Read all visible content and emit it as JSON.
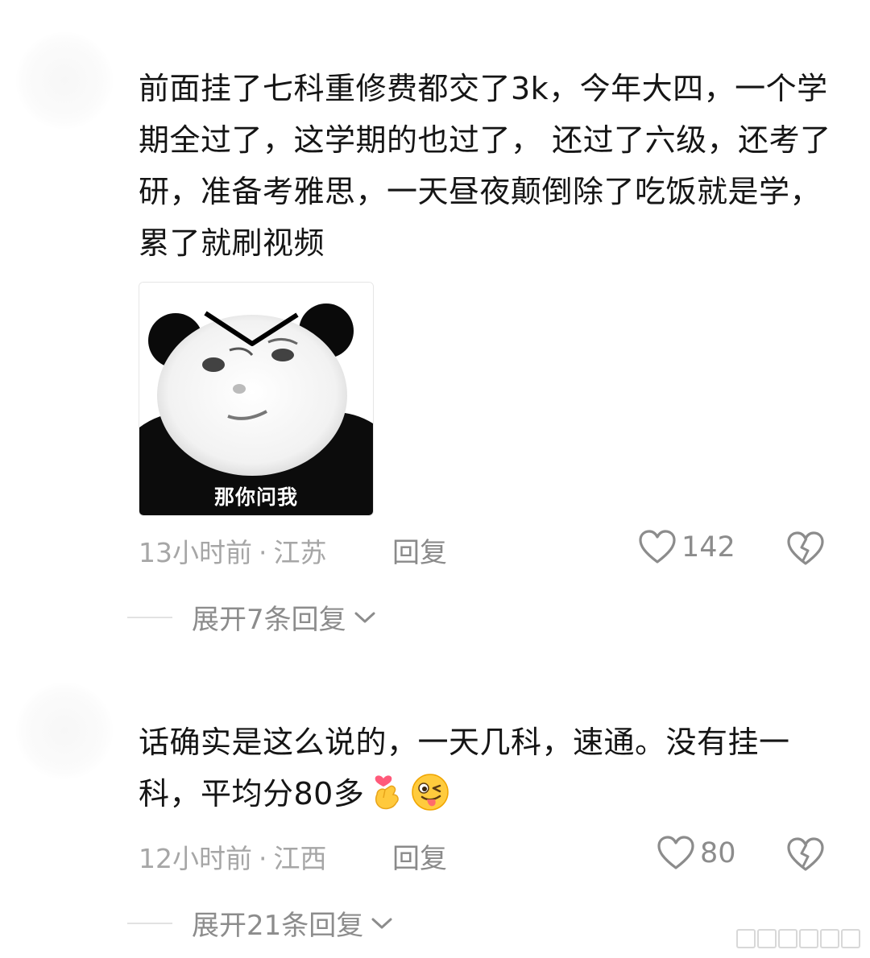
{
  "comments": [
    {
      "text": "前面挂了七科重修费都交了3k，今年大四，一个学期全过了，这学期的也过了， 还过了六级，还考了研，准备考雅思，一天昼夜颠倒除了吃饭就是学，累了就刷视频",
      "image_caption": "那你问我",
      "time": "13小时前",
      "location": "江苏",
      "separator": "·",
      "reply_label": "回复",
      "likes": "142",
      "expand_label": "展开7条回复"
    },
    {
      "text": "话确实是这么说的，一天几科，速通。没有挂一科，平均分80多",
      "emojis": [
        "finger-heart-emoji",
        "tongue-wink-emoji"
      ],
      "time": "12小时前",
      "location": "江西",
      "separator": "·",
      "reply_label": "回复",
      "likes": "80",
      "expand_label": "展开21条回复"
    }
  ],
  "colors": {
    "text": "#151515",
    "meta": "#a6a6a6",
    "action": "#8c8c8c"
  }
}
